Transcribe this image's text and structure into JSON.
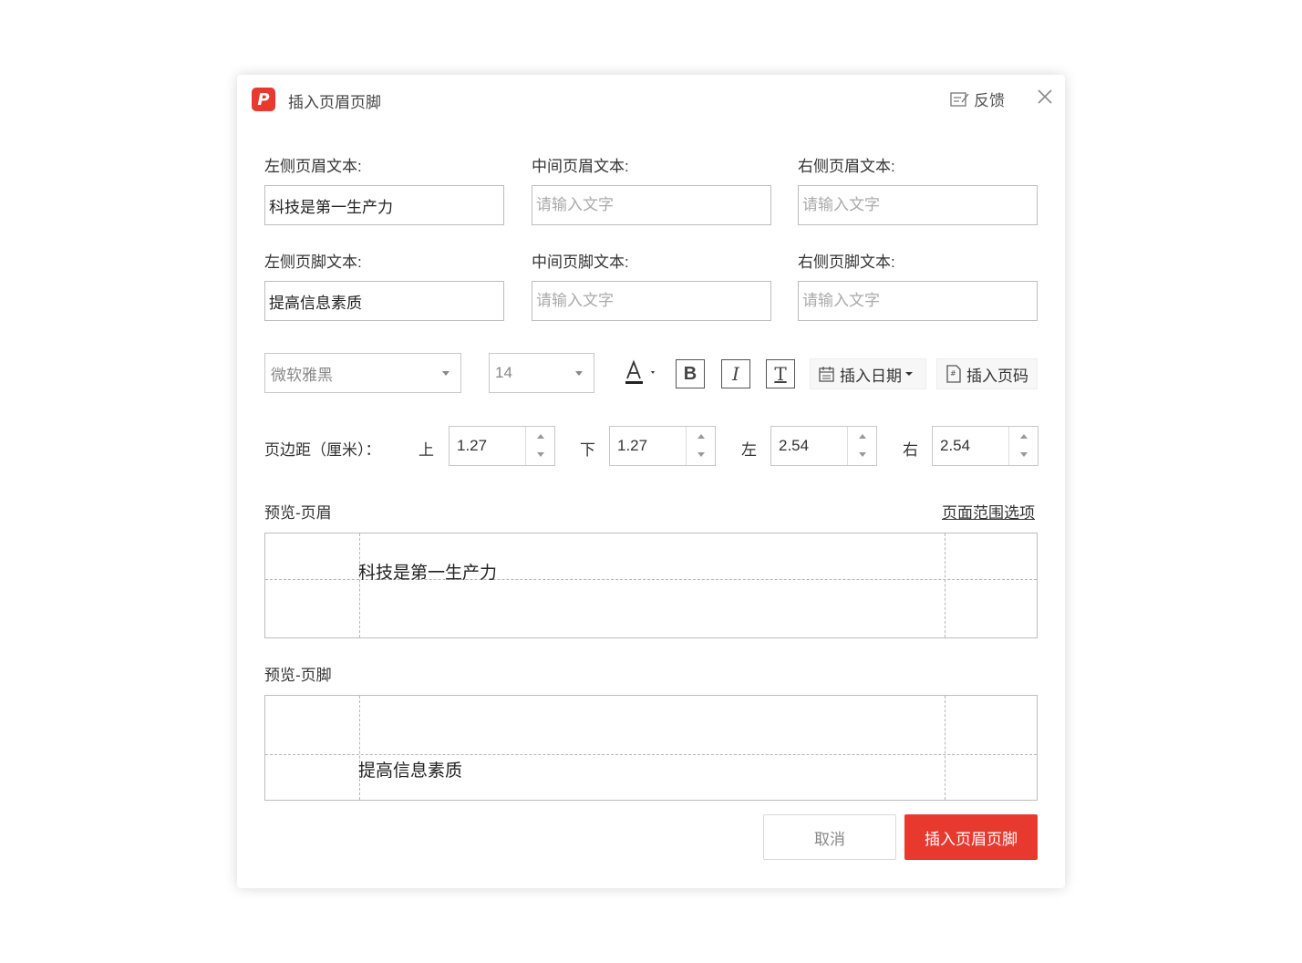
{
  "dialog": {
    "title": "插入页眉页脚",
    "feedback_label": "反馈"
  },
  "header_fields": {
    "left_label": "左侧页眉文本:",
    "center_label": "中间页眉文本:",
    "right_label": "右侧页眉文本:",
    "left_value": "科技是第一生产力",
    "center_value": "",
    "right_value": "",
    "placeholder": "请输入文字"
  },
  "footer_fields": {
    "left_label": "左侧页脚文本:",
    "center_label": "中间页脚文本:",
    "right_label": "右侧页脚文本:",
    "left_value": "提高信息素质",
    "center_value": "",
    "right_value": "",
    "placeholder": "请输入文字"
  },
  "format": {
    "font_name": "微软雅黑",
    "font_size": "14",
    "font_color_icon": "font-color-icon",
    "bold_glyph": "B",
    "italic_glyph": "I",
    "underline_glyph": "T",
    "insert_date_label": "插入日期",
    "insert_page_label": "插入页码"
  },
  "margins": {
    "label": "页边距（厘米）：",
    "top_label": "上",
    "top_value": "1.27",
    "bottom_label": "下",
    "bottom_value": "1.27",
    "left_label": "左",
    "left_value": "2.54",
    "right_label": "右",
    "right_value": "2.54"
  },
  "preview": {
    "header_title": "预览-页眉",
    "footer_title": "预览-页脚",
    "page_range_link": "页面范围选项",
    "header_text": "科技是第一生产力",
    "footer_text": "提高信息素质"
  },
  "buttons": {
    "cancel": "取消",
    "insert": "插入页眉页脚"
  },
  "colors": {
    "accent": "#e8392f"
  }
}
